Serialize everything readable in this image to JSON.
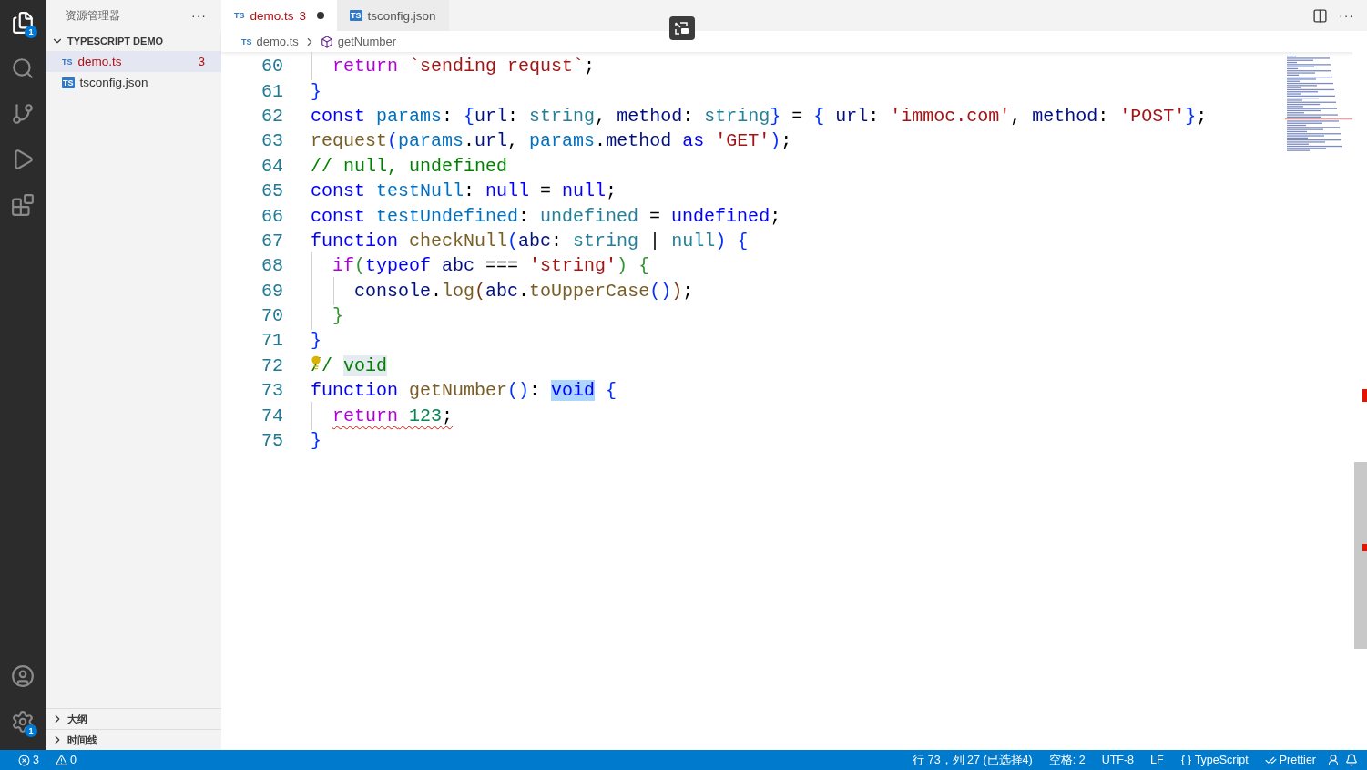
{
  "activity_bar": {
    "top": [
      {
        "kind": "explorer",
        "badge": "1",
        "selected": true
      },
      {
        "kind": "search",
        "selected": false
      },
      {
        "kind": "source-control",
        "selected": false
      },
      {
        "kind": "run-debug",
        "selected": false
      },
      {
        "kind": "extensions",
        "selected": false
      }
    ],
    "bottom": [
      {
        "kind": "account"
      },
      {
        "kind": "settings",
        "badge": "1"
      }
    ]
  },
  "sidebar": {
    "title": "资源管理器",
    "more": "···",
    "section": {
      "label": "TYPESCRIPT DEMO",
      "expanded": true,
      "files": [
        {
          "icon": "TS",
          "name": "demo.ts",
          "kind": "ts",
          "count": "3",
          "error": true,
          "selected": true
        },
        {
          "icon": "TS",
          "name": "tsconfig.json",
          "kind": "json",
          "error": false,
          "selected": false
        }
      ]
    },
    "panels": [
      {
        "label": "大纲",
        "expanded": false
      },
      {
        "label": "时间线",
        "expanded": false
      }
    ]
  },
  "tabs": [
    {
      "icon": "TS",
      "kind": "ts",
      "label": "demo.ts",
      "count": "3",
      "modified": true,
      "error": true,
      "selected": true
    },
    {
      "icon": "TS",
      "kind": "json",
      "label": "tsconfig.json",
      "modified": false,
      "error": false,
      "selected": false
    }
  ],
  "editor_actions": {
    "more": "···"
  },
  "breadcrumbs": [
    {
      "icon": "TS",
      "kind": "file",
      "label": "demo.ts"
    },
    {
      "kind": "symbol",
      "label": "getNumber"
    }
  ],
  "editor": {
    "lines": [
      {
        "number": "60",
        "error": false,
        "lightbulb": false,
        "tokens": [
          {
            "text": "  return",
            "kind": "control"
          },
          {
            "text": " `sending requst`",
            "kind": "string"
          },
          {
            "text": ";",
            "kind": "plain"
          }
        ]
      },
      {
        "number": "61",
        "error": false,
        "lightbulb": false,
        "tokens": [
          {
            "text": "}",
            "kind": "bracket1"
          }
        ]
      },
      {
        "number": "62",
        "error": false,
        "lightbulb": false,
        "tokens": [
          {
            "text": "const",
            "kind": "keyword"
          },
          {
            "text": " params",
            "kind": "constant"
          },
          {
            "text": ": ",
            "kind": "plain"
          },
          {
            "text": "{",
            "kind": "bracket1"
          },
          {
            "text": "url",
            "kind": "variable"
          },
          {
            "text": ": ",
            "kind": "plain"
          },
          {
            "text": "string",
            "kind": "type"
          },
          {
            "text": ", ",
            "kind": "plain"
          },
          {
            "text": "method",
            "kind": "variable"
          },
          {
            "text": ": ",
            "kind": "plain"
          },
          {
            "text": "string",
            "kind": "type"
          },
          {
            "text": "}",
            "kind": "bracket1"
          },
          {
            "text": " = ",
            "kind": "plain"
          },
          {
            "text": "{",
            "kind": "bracket1"
          },
          {
            "text": " url",
            "kind": "variable"
          },
          {
            "text": ": ",
            "kind": "plain"
          },
          {
            "text": "'immoc.com'",
            "kind": "string"
          },
          {
            "text": ", ",
            "kind": "plain"
          },
          {
            "text": "method",
            "kind": "variable"
          },
          {
            "text": ": ",
            "kind": "plain"
          },
          {
            "text": "'POST'",
            "kind": "string"
          },
          {
            "text": "}",
            "kind": "bracket1"
          },
          {
            "text": ";",
            "kind": "plain"
          }
        ]
      },
      {
        "number": "63",
        "error": false,
        "lightbulb": false,
        "tokens": [
          {
            "text": "request",
            "kind": "function"
          },
          {
            "text": "(",
            "kind": "bracket1"
          },
          {
            "text": "params",
            "kind": "constant"
          },
          {
            "text": ".",
            "kind": "plain"
          },
          {
            "text": "url",
            "kind": "variable"
          },
          {
            "text": ", ",
            "kind": "plain"
          },
          {
            "text": "params",
            "kind": "constant"
          },
          {
            "text": ".",
            "kind": "plain"
          },
          {
            "text": "method",
            "kind": "variable"
          },
          {
            "text": " as ",
            "kind": "keyword"
          },
          {
            "text": "'GET'",
            "kind": "string"
          },
          {
            "text": ")",
            "kind": "bracket1"
          },
          {
            "text": ";",
            "kind": "plain"
          }
        ]
      },
      {
        "number": "64",
        "error": false,
        "lightbulb": false,
        "tokens": [
          {
            "text": "// null, undefined",
            "kind": "comment"
          }
        ]
      },
      {
        "number": "65",
        "error": false,
        "lightbulb": false,
        "tokens": [
          {
            "text": "const",
            "kind": "keyword"
          },
          {
            "text": " testNull",
            "kind": "constant"
          },
          {
            "text": ": ",
            "kind": "plain"
          },
          {
            "text": "null",
            "kind": "keyword"
          },
          {
            "text": " = ",
            "kind": "plain"
          },
          {
            "text": "null",
            "kind": "keyword"
          },
          {
            "text": ";",
            "kind": "plain"
          }
        ]
      },
      {
        "number": "66",
        "error": false,
        "lightbulb": false,
        "tokens": [
          {
            "text": "const",
            "kind": "keyword"
          },
          {
            "text": " testUndefined",
            "kind": "constant"
          },
          {
            "text": ": ",
            "kind": "plain"
          },
          {
            "text": "undefined",
            "kind": "type"
          },
          {
            "text": " = ",
            "kind": "plain"
          },
          {
            "text": "undefined",
            "kind": "keyword"
          },
          {
            "text": ";",
            "kind": "plain"
          }
        ]
      },
      {
        "number": "67",
        "error": false,
        "lightbulb": false,
        "tokens": [
          {
            "text": "function",
            "kind": "keyword"
          },
          {
            "text": " checkNull",
            "kind": "function"
          },
          {
            "text": "(",
            "kind": "bracket1"
          },
          {
            "text": "abc",
            "kind": "variable"
          },
          {
            "text": ": ",
            "kind": "plain"
          },
          {
            "text": "string",
            "kind": "type"
          },
          {
            "text": " | ",
            "kind": "plain"
          },
          {
            "text": "null",
            "kind": "type"
          },
          {
            "text": ")",
            "kind": "bracket1"
          },
          {
            "text": " {",
            "kind": "bracket1"
          }
        ]
      },
      {
        "number": "68",
        "error": false,
        "lightbulb": false,
        "tokens": [
          {
            "text": "  if",
            "kind": "control"
          },
          {
            "text": "(",
            "kind": "bracket2"
          },
          {
            "text": "typeof",
            "kind": "keyword"
          },
          {
            "text": " abc",
            "kind": "variable"
          },
          {
            "text": " === ",
            "kind": "plain"
          },
          {
            "text": "'string'",
            "kind": "string"
          },
          {
            "text": ")",
            "kind": "bracket2"
          },
          {
            "text": " {",
            "kind": "bracket2"
          }
        ]
      },
      {
        "number": "69",
        "error": false,
        "lightbulb": false,
        "tokens": [
          {
            "text": "    console",
            "kind": "variable"
          },
          {
            "text": ".",
            "kind": "plain"
          },
          {
            "text": "log",
            "kind": "function"
          },
          {
            "text": "(",
            "kind": "bracket3"
          },
          {
            "text": "abc",
            "kind": "variable"
          },
          {
            "text": ".",
            "kind": "plain"
          },
          {
            "text": "toUpperCase",
            "kind": "function"
          },
          {
            "text": "()",
            "kind": "bracket1"
          },
          {
            "text": ")",
            "kind": "bracket3"
          },
          {
            "text": ";",
            "kind": "plain"
          }
        ]
      },
      {
        "number": "70",
        "error": false,
        "lightbulb": false,
        "tokens": [
          {
            "text": "  }",
            "kind": "bracket2"
          }
        ]
      },
      {
        "number": "71",
        "error": false,
        "lightbulb": false,
        "tokens": [
          {
            "text": "}",
            "kind": "bracket1"
          }
        ]
      },
      {
        "number": "72",
        "error": false,
        "lightbulb": true,
        "tokens": [
          {
            "text": "// ",
            "kind": "comment"
          },
          {
            "text": "void",
            "kind": "comment",
            "highlighted": true
          }
        ]
      },
      {
        "number": "73",
        "error": false,
        "lightbulb": false,
        "tokens": [
          {
            "text": "function",
            "kind": "keyword"
          },
          {
            "text": " getNumber",
            "kind": "function"
          },
          {
            "text": "()",
            "kind": "bracket1"
          },
          {
            "text": ": ",
            "kind": "plain"
          },
          {
            "text": "void",
            "kind": "keyword",
            "selected": true
          },
          {
            "text": " {",
            "kind": "bracket1"
          }
        ]
      },
      {
        "number": "74",
        "error": true,
        "lightbulb": false,
        "tokens": [
          {
            "text": "  return",
            "kind": "control"
          },
          {
            "text": " 123",
            "kind": "number"
          },
          {
            "text": ";",
            "kind": "plain"
          }
        ]
      },
      {
        "number": "75",
        "error": false,
        "lightbulb": false,
        "tokens": [
          {
            "text": "}",
            "kind": "bracket1"
          }
        ]
      }
    ]
  },
  "status_bar": {
    "left": [
      {
        "kind": "errors",
        "text": "3"
      },
      {
        "kind": "warnings",
        "text": "0"
      }
    ],
    "right": [
      {
        "kind": "text",
        "text": "行 73，列 27 (已选择4)"
      },
      {
        "kind": "text",
        "text": "空格: 2"
      },
      {
        "kind": "text",
        "text": "UTF-8"
      },
      {
        "kind": "text",
        "text": "LF"
      },
      {
        "kind": "language",
        "text": "TypeScript"
      },
      {
        "kind": "check",
        "text": "Prettier"
      },
      {
        "kind": "feedback"
      },
      {
        "kind": "bell"
      }
    ]
  }
}
